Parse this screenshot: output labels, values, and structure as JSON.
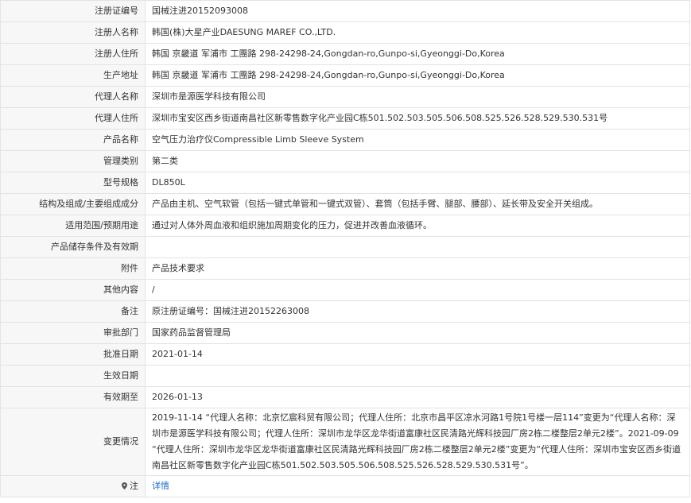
{
  "rows": [
    {
      "label": "注册证编号",
      "value": "国械注进20152093008"
    },
    {
      "label": "注册人名称",
      "value": "韩国(株)大星产业DAESUNG MAREF CO.,LTD."
    },
    {
      "label": "注册人住所",
      "value": "韩国 京畿道 军浦市 工團路 298-24298-24,Gongdan-ro,Gunpo-si,Gyeonggi-Do,Korea"
    },
    {
      "label": "生产地址",
      "value": "韩国 京畿道 军浦市 工團路 298-24298-24,Gongdan-ro,Gunpo-si,Gyeonggi-Do,Korea"
    },
    {
      "label": "代理人名称",
      "value": "深圳市是源医学科技有限公司"
    },
    {
      "label": "代理人住所",
      "value": "深圳市宝安区西乡街道南昌社区新零售数字化产业园C栋501.502.503.505.506.508.525.526.528.529.530.531号"
    },
    {
      "label": "产品名称",
      "value": "空气压力治疗仪Compressible Limb Sleeve System"
    },
    {
      "label": "管理类别",
      "value": "第二类"
    },
    {
      "label": "型号规格",
      "value": "DL850L"
    },
    {
      "label": "结构及组成/主要组成成分",
      "value": "产品由主机、空气软管（包括一键式单管和一键式双管）、套筒（包括手臂、腿部、腰部）、延长带及安全开关组成。"
    },
    {
      "label": "适用范围/预期用途",
      "value": "通过对人体外周血液和组织施加周期变化的压力，促进并改善血液循环。"
    },
    {
      "label": "产品储存条件及有效期",
      "value": ""
    },
    {
      "label": "附件",
      "value": "产品技术要求"
    },
    {
      "label": "其他内容",
      "value": "/"
    },
    {
      "label": "备注",
      "value": "原注册证编号：国械注进20152263008"
    },
    {
      "label": "审批部门",
      "value": "国家药品监督管理局"
    },
    {
      "label": "批准日期",
      "value": "2021-01-14"
    },
    {
      "label": "生效日期",
      "value": ""
    },
    {
      "label": "有效期至",
      "value": "2026-01-13"
    }
  ],
  "changes": {
    "label": "变更情况",
    "value": "2019-11-14 “代理人名称：北京忆宸科贸有限公司；代理人住所：北京市昌平区凉水河路1号院1号楼一层114”变更为“代理人名称：深圳市是源医学科技有限公司；代理人住所：深圳市龙华区龙华街道富康社区民清路光辉科技园厂房2栋二楼整层2单元2楼”。2021-09-09 “代理人住所：深圳市龙华区龙华街道富康社区民清路光辉科技园厂房2栋二楼整层2单元2楼”变更为“代理人住所：深圳市宝安区西乡街道南昌社区新零售数字化产业园C栋501.502.503.505.506.508.525.526.528.529.530.531号”。"
  },
  "note": {
    "label": "注",
    "icon": "location-pin-icon",
    "link_text": "详情"
  }
}
